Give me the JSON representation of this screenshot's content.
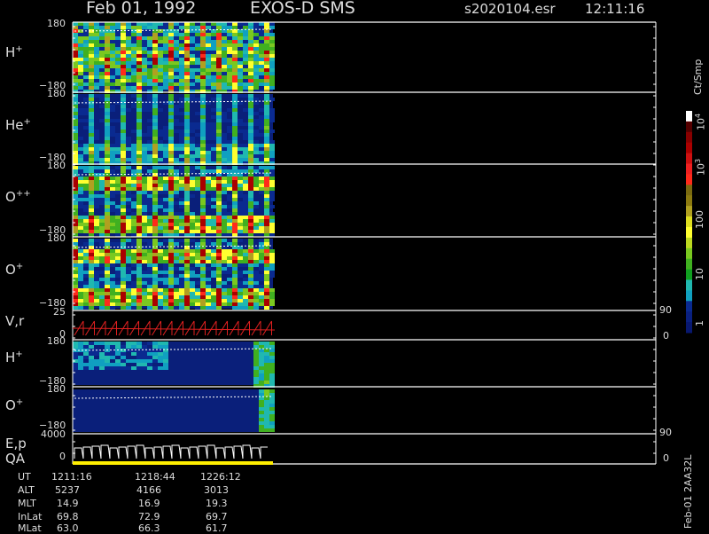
{
  "header": {
    "date": "Feb 01, 1992",
    "instrument": "EXOS-D SMS",
    "file": "s2020104.esr",
    "time": "12:11:16"
  },
  "panels": [
    {
      "id": "h-plus",
      "species": "H",
      "charge": "+",
      "ymax": "180",
      "ymin": "−180",
      "style": "dense"
    },
    {
      "id": "he-plus",
      "species": "He",
      "charge": "+",
      "ymax": "180",
      "ymin": "−180",
      "style": "sparse"
    },
    {
      "id": "o-plusplus",
      "species": "O",
      "charge": "++",
      "ymax": "180",
      "ymin": "−180",
      "style": "medium"
    },
    {
      "id": "o-plus",
      "species": "O",
      "charge": "+",
      "ymax": "180",
      "ymin": "−180",
      "style": "medium"
    },
    {
      "id": "h-plus-2",
      "species": "H",
      "charge": "+",
      "ymax": "180",
      "ymin": "−180",
      "style": "faint"
    },
    {
      "id": "o-plus-2",
      "species": "O",
      "charge": "+",
      "ymax": "180",
      "ymin": "−180",
      "style": "empty"
    }
  ],
  "vr_panel": {
    "label": "V,r",
    "ymax": "25",
    "ymin": "0",
    "rmax": "90",
    "rmin": "0"
  },
  "ep_panel": {
    "label1": "E,p",
    "label2": "QA",
    "ymax": "4000",
    "ymin": "0",
    "rmax": "90",
    "rmin": "0"
  },
  "colorbar": {
    "unit": "Ct/Smp",
    "ticks": [
      {
        "label": "10",
        "sup": "4"
      },
      {
        "label": "10",
        "sup": "3"
      },
      {
        "label": "100",
        "sup": ""
      },
      {
        "label": "10",
        "sup": ""
      },
      {
        "label": "1",
        "sup": ""
      }
    ],
    "colors": [
      "#ffffff",
      "#550000",
      "#880000",
      "#aa0000",
      "#cc1010",
      "#ee2020",
      "#ff2a1a",
      "#7a6a10",
      "#8c7a10",
      "#b0a020",
      "#dede20",
      "#ffff30",
      "#bcd820",
      "#7ac820",
      "#40b020",
      "#10a020",
      "#20b8b0",
      "#10a0c0",
      "#0a2a90",
      "#0a2080",
      "#081870"
    ]
  },
  "ephemeris": {
    "rows": [
      {
        "name": "UT",
        "values": [
          "1211:16",
          "1218:44",
          "1226:12"
        ]
      },
      {
        "name": "ALT",
        "values": [
          "5237",
          "4166",
          "3013"
        ]
      },
      {
        "name": "MLT",
        "values": [
          "14.9",
          "16.9",
          "19.3"
        ]
      },
      {
        "name": "InLat",
        "values": [
          "69.8",
          "72.9",
          "69.7"
        ]
      },
      {
        "name": "MLat",
        "values": [
          "63.0",
          "66.3",
          "61.7"
        ]
      }
    ]
  },
  "footer_id": "Feb-01 2AA32L",
  "chart_data": {
    "type": "heatmap",
    "title": "Feb 01, 1992   EXOS-D SMS",
    "x": [
      "1211:16",
      "1218:44",
      "1226:12"
    ],
    "xlabel": "UT",
    "panels": [
      "H+",
      "He+",
      "O++",
      "O+",
      "V,r",
      "H+",
      "O+",
      "E,p / QA"
    ],
    "ylim": [
      -180,
      180
    ],
    "color_scale": "log",
    "color_range": [
      1,
      10000
    ],
    "color_label": "Ct/Smp"
  }
}
